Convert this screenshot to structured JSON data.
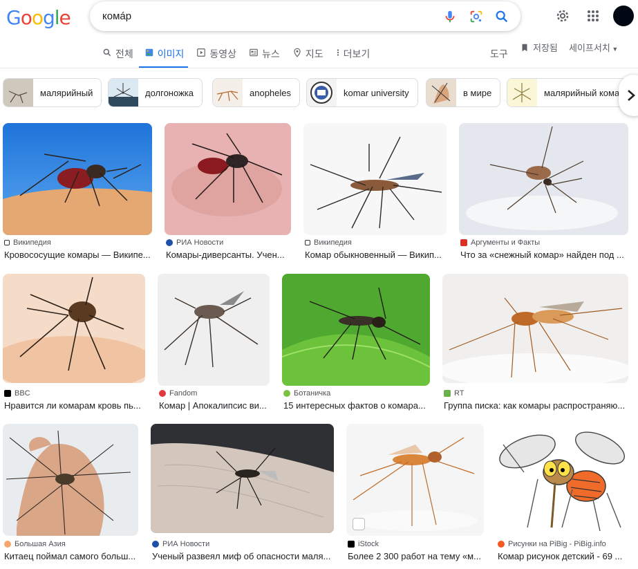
{
  "logo": "Google",
  "search": {
    "query": "комáр"
  },
  "tabs": [
    {
      "label": "전체",
      "icon": "search-icon"
    },
    {
      "label": "이미지",
      "icon": "image-icon",
      "active": true
    },
    {
      "label": "동영상",
      "icon": "play-icon"
    },
    {
      "label": "뉴스",
      "icon": "news-icon"
    },
    {
      "label": "지도",
      "icon": "map-pin-icon"
    },
    {
      "label": "더보기",
      "icon": "more-vert-icon"
    }
  ],
  "tools_label": "도구",
  "saved_label": "저장됨",
  "safesearch_label": "세이프서치",
  "chips": [
    {
      "label": "малярийный"
    },
    {
      "label": "долгоножка"
    },
    {
      "label": "anopheles"
    },
    {
      "label": "komar university"
    },
    {
      "label": "в мире"
    },
    {
      "label": "малярийный кома"
    }
  ],
  "results": [
    {
      "source": "Википедия",
      "title": "Кровососущие комары — Википе..."
    },
    {
      "source": "РИА Новости",
      "title": "Комары-диверсанты. Учен..."
    },
    {
      "source": "Википедия",
      "title": "Комар обыкновенный — Викип..."
    },
    {
      "source": "Аргументы и Факты",
      "title": "Что за «снежный комар» найден под ..."
    },
    {
      "source": "BBC",
      "title": "Нравится ли комарам кровь пь..."
    },
    {
      "source": "Fandom",
      "title": "Комар | Апокалипсис ви..."
    },
    {
      "source": "Ботаничка",
      "title": "15 интересных фактов о комара..."
    },
    {
      "source": "RT",
      "title": "Группа писка: как комары распространяю..."
    },
    {
      "source": "Большая Азия",
      "title": "Китаец поймал самого больш..."
    },
    {
      "source": "РИА Новости",
      "title": "Ученый развеял миф об опасности маля..."
    },
    {
      "source": "iStock",
      "title": "Более 2 300 работ на тему «м..."
    },
    {
      "source": "Рисунки на PiBig - PiBig.info",
      "title": "Комар рисунок детский - 69 ..."
    }
  ],
  "colors": {
    "accent": "#1a73e8",
    "text": "#202124",
    "secondary": "#5f6368"
  }
}
